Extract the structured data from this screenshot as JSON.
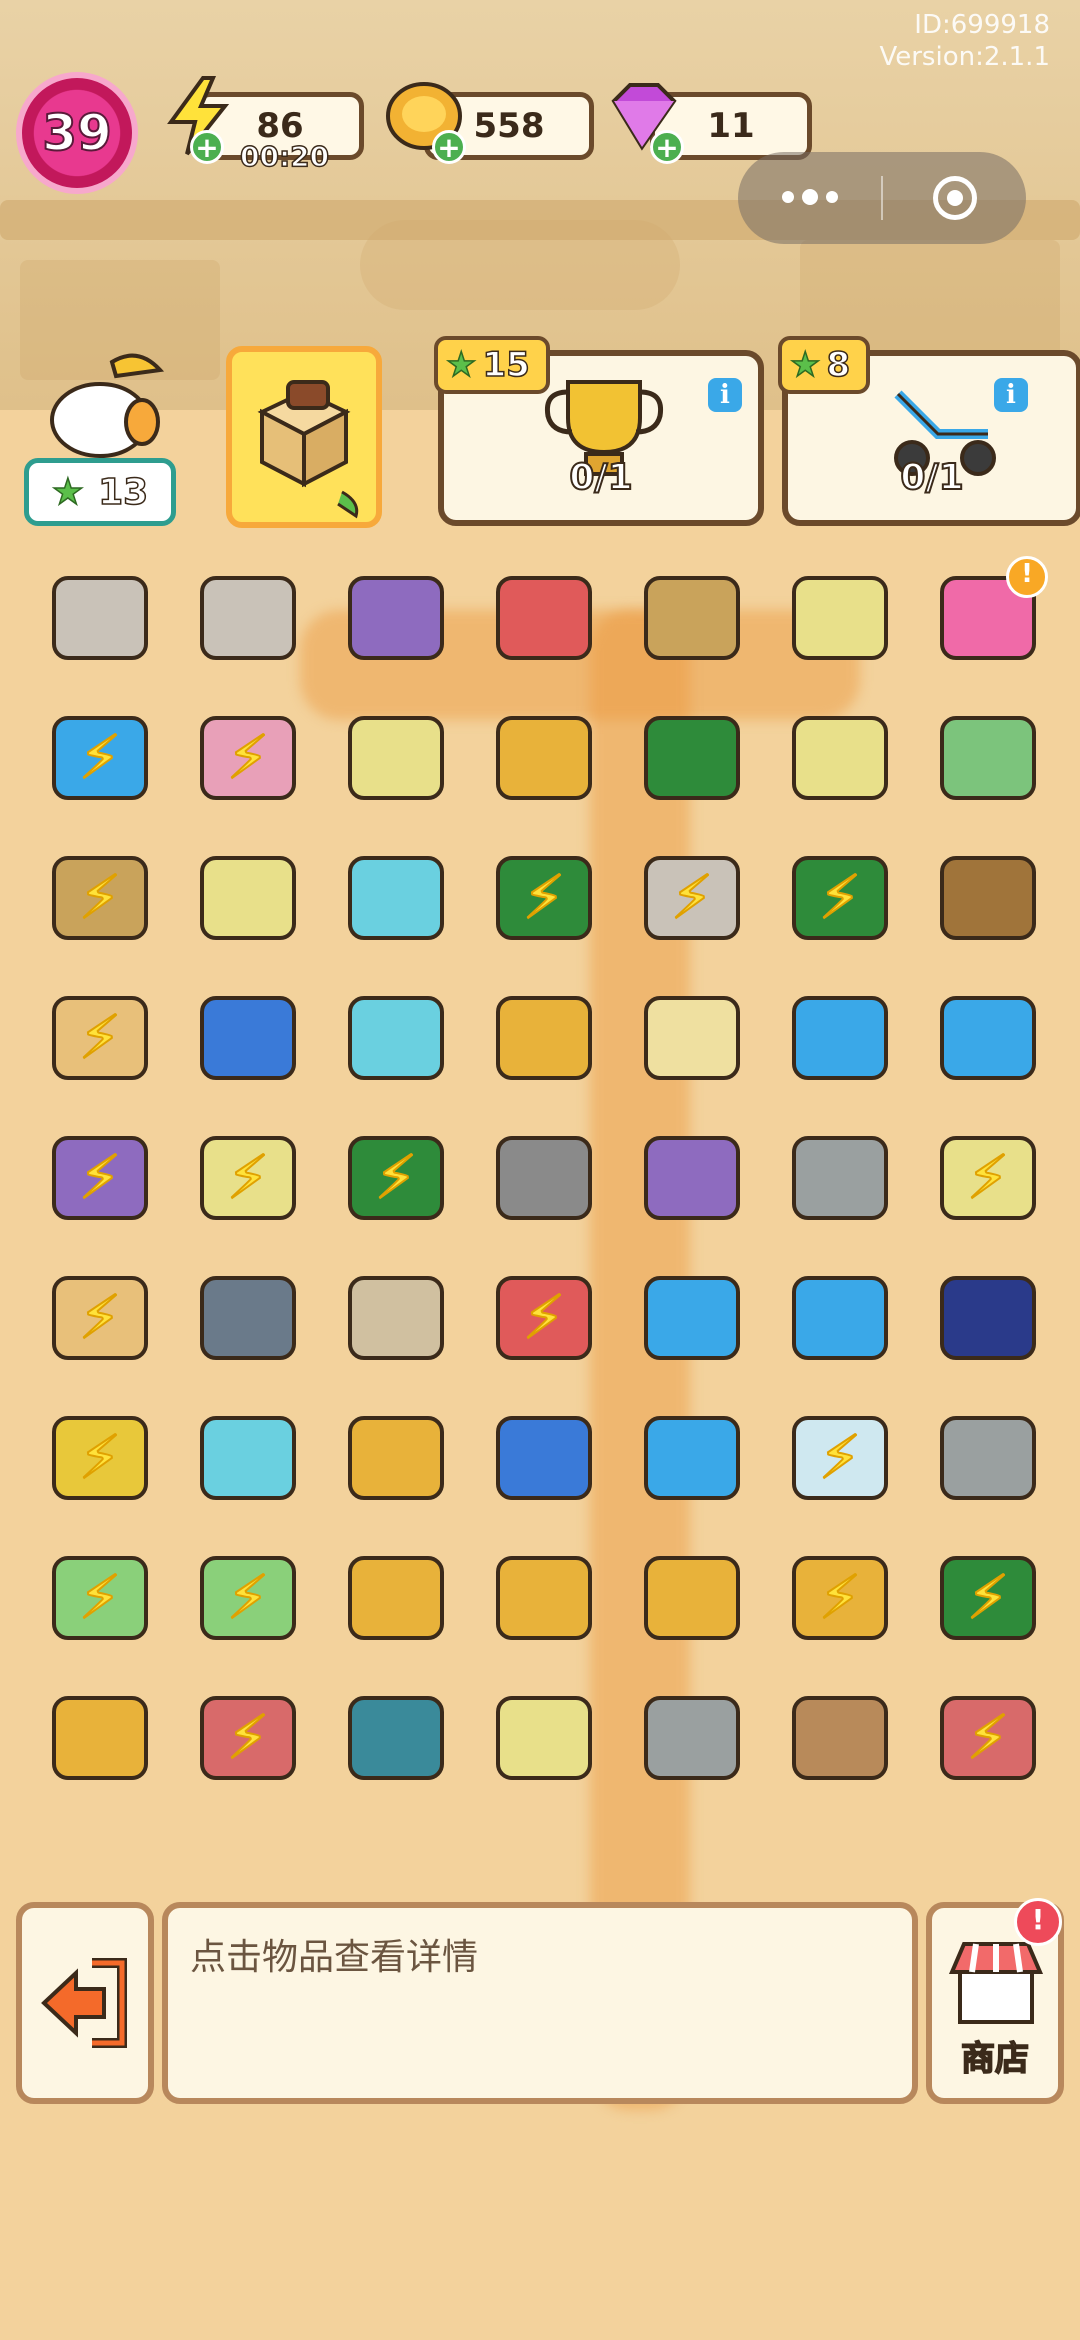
{
  "header": {
    "user_id": "ID:699918",
    "version": "Version:2.1.1"
  },
  "player": {
    "level": "39",
    "stars": "13"
  },
  "resources": {
    "energy": "86",
    "energy_timer": "00:20",
    "coins": "558",
    "gems": "11"
  },
  "quests": [
    {
      "reward_stars": "15",
      "progress": "0/1",
      "item": "trophy-icon"
    },
    {
      "reward_stars": "8",
      "progress": "0/1",
      "item": "scooter-icon"
    }
  ],
  "board": {
    "rows": [
      [
        {
          "icon": "statue",
          "c": "#c9c2b8"
        },
        {
          "icon": "bird-statue",
          "c": "#c9c2b8"
        },
        {
          "icon": "junk-pile",
          "c": "#8e6bbf"
        },
        {
          "icon": "vr-goggles",
          "c": "#e05a5a"
        },
        {
          "icon": "basket",
          "c": "#c9a35b"
        },
        {
          "icon": "frame",
          "c": "#e8e08a"
        },
        {
          "icon": "pink-backpack",
          "c": "#f06aa8",
          "alert": true
        }
      ],
      [
        {
          "icon": "robot-vacuum",
          "c": "#3aa8e8",
          "bolt": true
        },
        {
          "icon": "egg-lamp",
          "c": "#e8a0b8",
          "bolt": true
        },
        {
          "icon": "basket-crate",
          "c": "#e8e08a"
        },
        {
          "icon": "medal",
          "c": "#e8b23a"
        },
        {
          "icon": "green-toolbox",
          "c": "#2e8b3a"
        },
        {
          "icon": "frame",
          "c": "#e8e08a"
        },
        {
          "icon": "cash-stack",
          "c": "#7cc47c"
        }
      ],
      [
        {
          "icon": "fruit-basket",
          "c": "#c9a35b",
          "bolt": true
        },
        {
          "icon": "cart-gear",
          "c": "#e8e08a"
        },
        {
          "icon": "blue-ribbon",
          "c": "#6ad0e0"
        },
        {
          "icon": "green-chest",
          "c": "#2e8b3a",
          "bolt": true
        },
        {
          "icon": "bird-statue",
          "c": "#c9c2b8",
          "bolt": true
        },
        {
          "icon": "green-machine",
          "c": "#2e8b3a",
          "bolt": true
        },
        {
          "icon": "rope-coil",
          "c": "#a0743a"
        }
      ],
      [
        {
          "icon": "cardboard-box",
          "c": "#e8c07a",
          "bolt": true
        },
        {
          "icon": "blue-radio",
          "c": "#3a7ad8"
        },
        {
          "icon": "dumbbells",
          "c": "#6ad0e0"
        },
        {
          "icon": "gold-coins",
          "c": "#e8b23a"
        },
        {
          "icon": "yarn-ball",
          "c": "#efe0a0"
        },
        {
          "icon": "jump-rope",
          "c": "#3aa8e8"
        },
        {
          "icon": "exercise-bench",
          "c": "#3aa8e8"
        }
      ],
      [
        {
          "icon": "junk-pile",
          "c": "#8e6bbf",
          "bolt": true
        },
        {
          "icon": "cart-weights",
          "c": "#e8e08a",
          "bolt": true
        },
        {
          "icon": "green-tub",
          "c": "#2e8b3a",
          "bolt": true
        },
        {
          "icon": "frying-pan",
          "c": "#8a8a8a"
        },
        {
          "icon": "purple-bin",
          "c": "#8e6bbf"
        },
        {
          "icon": "drill",
          "c": "#9aa0a0"
        },
        {
          "icon": "chick-cart",
          "c": "#e8e08a",
          "bolt": true
        }
      ],
      [
        {
          "icon": "potted-plant",
          "c": "#e8c07a",
          "bolt": true
        },
        {
          "icon": "treadmill",
          "c": "#6a7a8a"
        },
        {
          "icon": "locker",
          "c": "#d0c0a0"
        },
        {
          "icon": "toy-crate",
          "c": "#e05a5a",
          "bolt": true
        },
        {
          "icon": "capacitor",
          "c": "#3aa8e8"
        },
        {
          "icon": "hula-hoop",
          "c": "#3aa8e8"
        },
        {
          "icon": "headphones",
          "c": "#2a3a8a"
        }
      ],
      [
        {
          "icon": "yellow-cart",
          "c": "#e8c83a",
          "bolt": true
        },
        {
          "icon": "shop-building",
          "c": "#6ad0e0"
        },
        {
          "icon": "gold-medal",
          "c": "#e8b23a"
        },
        {
          "icon": "circuit-board",
          "c": "#3a7ad8"
        },
        {
          "icon": "capacitors",
          "c": "#3aa8e8"
        },
        {
          "icon": "robot-vacuum-box",
          "c": "#cfe8f0",
          "bolt": true
        },
        {
          "icon": "grip-trainer",
          "c": "#9aa0a0"
        }
      ],
      [
        {
          "icon": "laptop",
          "c": "#8ad07a",
          "bolt": true
        },
        {
          "icon": "laptop-clock",
          "c": "#8ad07a",
          "bolt": true
        },
        {
          "icon": "open-box",
          "c": "#e8b23a"
        },
        {
          "icon": "cabinet-cactus",
          "c": "#e8b23a"
        },
        {
          "icon": "cabinet-cactus",
          "c": "#e8b23a"
        },
        {
          "icon": "cabinet-cactus",
          "c": "#e8b23a",
          "bolt": true
        },
        {
          "icon": "green-crate",
          "c": "#2e8b3a",
          "bolt": true
        }
      ],
      [
        {
          "icon": "drawer-cabinet",
          "c": "#e8b23a"
        },
        {
          "icon": "wheelbarrow",
          "c": "#d86a6a",
          "bolt": true
        },
        {
          "icon": "lifeguard-chair",
          "c": "#3a8a9a"
        },
        {
          "icon": "weight-basket",
          "c": "#e8e08a"
        },
        {
          "icon": "barbell-stand",
          "c": "#9aa0a0"
        },
        {
          "icon": "mortar-pestle",
          "c": "#b88a5a"
        },
        {
          "icon": "wheelbarrow",
          "c": "#d86a6a",
          "bolt": true
        }
      ]
    ]
  },
  "details_panel": {
    "hint": "点击物品查看详情"
  },
  "shop": {
    "label": "商店"
  },
  "colors": {
    "level_pink": "#e8398f",
    "energy_yellow": "#ffe23a",
    "coin_gold": "#f2b233",
    "gem_purple": "#c24ad8",
    "accent_teal": "#2e9d8f"
  }
}
